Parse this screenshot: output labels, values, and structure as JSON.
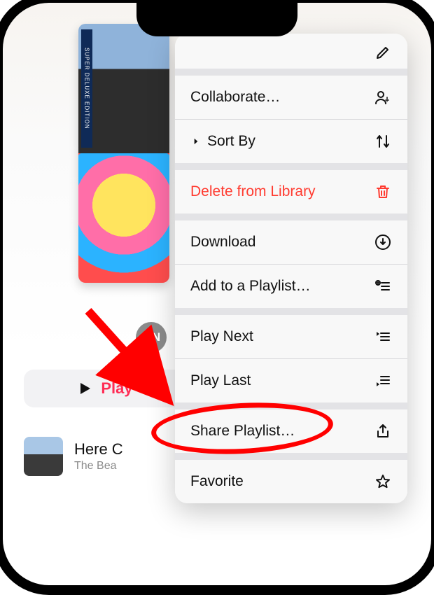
{
  "album_grid": {
    "tile_a_label": "SUPER DELUXE EDITION"
  },
  "badge": {
    "initials": "MN"
  },
  "play_button": {
    "label": "Play"
  },
  "song": {
    "title": "Here C",
    "artist": "The Bea"
  },
  "menu": {
    "edit_hint": "Edit",
    "items": {
      "collaborate": "Collaborate…",
      "sort_by": "Sort By",
      "delete": "Delete from Library",
      "download": "Download",
      "add_playlist": "Add to a Playlist…",
      "play_next": "Play Next",
      "play_last": "Play Last",
      "share": "Share Playlist…",
      "favorite": "Favorite"
    }
  },
  "colors": {
    "accent": "#ff2d55",
    "danger": "#ff3b30"
  }
}
